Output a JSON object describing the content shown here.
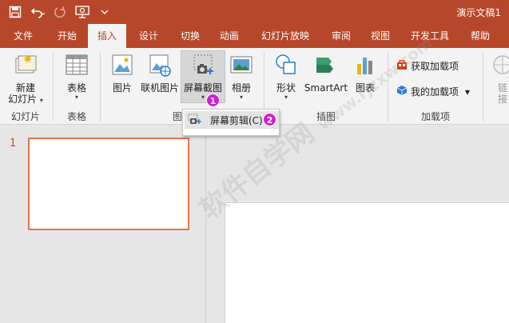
{
  "titlebar": {
    "doc_title": "演示文稿1",
    "bg_color": "#b7472a",
    "qat_icons": [
      "save-icon",
      "undo-icon",
      "redo-icon",
      "present-icon",
      "customize-icon"
    ]
  },
  "tabs": [
    {
      "label": "文件"
    },
    {
      "label": "开始"
    },
    {
      "label": "插入",
      "active": true
    },
    {
      "label": "设计"
    },
    {
      "label": "切换"
    },
    {
      "label": "动画"
    },
    {
      "label": "幻灯片放映"
    },
    {
      "label": "审阅"
    },
    {
      "label": "视图"
    },
    {
      "label": "开发工具"
    },
    {
      "label": "帮助"
    }
  ],
  "ribbon": {
    "new_slide": {
      "label_line1": "新建",
      "label_line2": "幻灯片"
    },
    "table": {
      "label": "表格"
    },
    "picture": {
      "label": "图片"
    },
    "online_picture": {
      "label": "联机图片"
    },
    "screenshot": {
      "label": "屏幕截图"
    },
    "album": {
      "label": "相册"
    },
    "shapes": {
      "label": "形状"
    },
    "smartart": {
      "label": "SmartArt"
    },
    "chart": {
      "label": "图表"
    },
    "get_addins": {
      "label": "获取加载项"
    },
    "my_addins": {
      "label": "我的加载项"
    },
    "link_partial": {
      "line1": "链",
      "line2": "接"
    },
    "groups": {
      "slides": "幻灯片",
      "tables": "表格",
      "images_partial": "图",
      "illustrations": "插图",
      "addins": "加载项"
    }
  },
  "dropdown": {
    "item_label": "屏幕剪辑(C)"
  },
  "badges": {
    "step1": "1",
    "step2": "2",
    "color": "#d01fd0"
  },
  "slides_pane": {
    "slide_number": "1"
  },
  "watermark": {
    "text": "软件自学网",
    "url": "www.rjzxw.com"
  }
}
